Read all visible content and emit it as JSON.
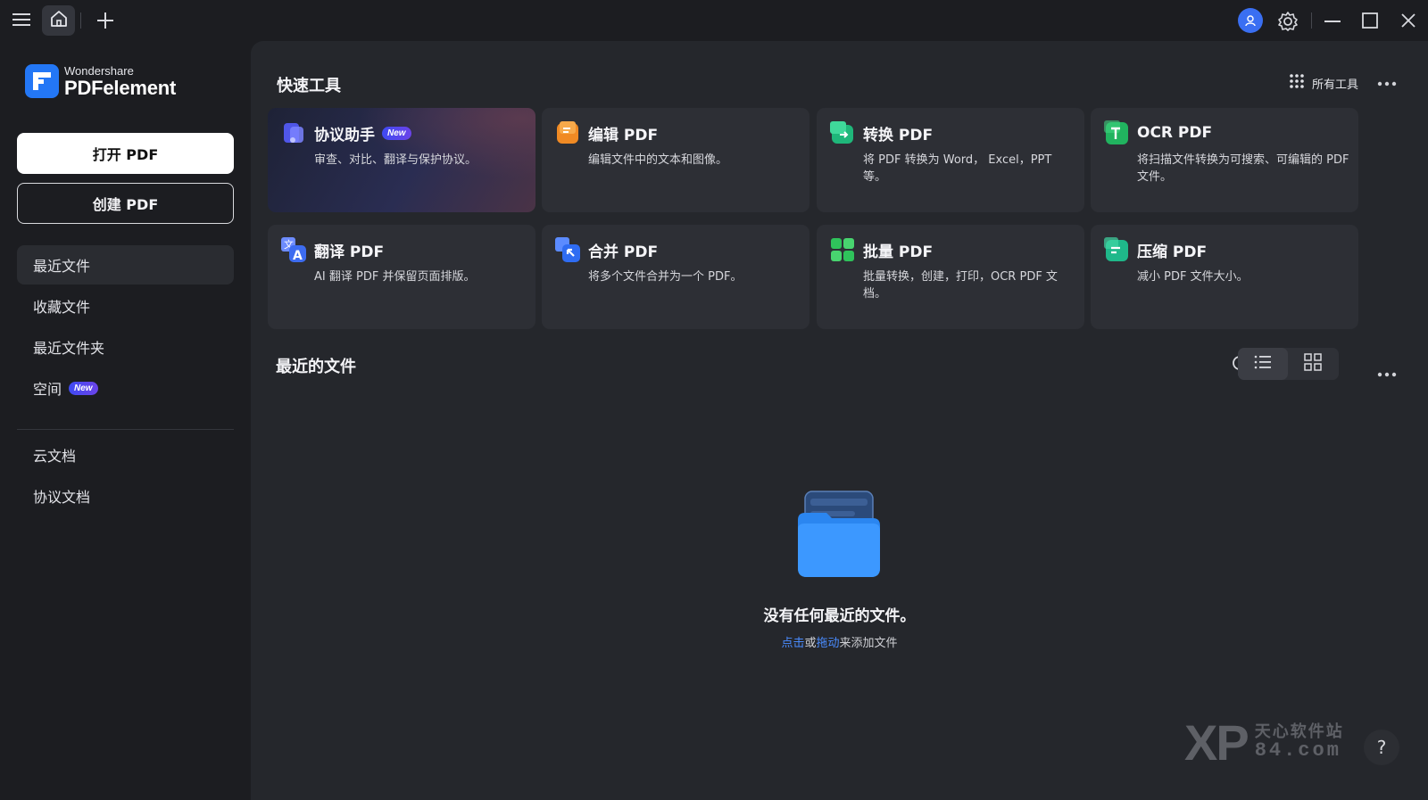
{
  "titlebar": {
    "icons": [
      "menu-icon",
      "home-icon",
      "plus-icon",
      "user-avatar-icon",
      "gear-icon",
      "minimize-icon",
      "maximize-icon",
      "close-icon"
    ]
  },
  "brand": {
    "sub": "Wondershare",
    "main": "PDFelement",
    "color": "#2377f6"
  },
  "sidebar": {
    "open_label": "打开 PDF",
    "create_label": "创建 PDF",
    "items": [
      {
        "label": "最近文件",
        "active": true
      },
      {
        "label": "收藏文件"
      },
      {
        "label": "最近文件夹"
      },
      {
        "label": "空间",
        "badge": "New"
      },
      {
        "label": "云文档"
      },
      {
        "label": "协议文档"
      }
    ]
  },
  "quick_tools": {
    "title": "快速工具",
    "all_tools_label": "所有工具",
    "tools": [
      {
        "name": "协议助手",
        "badge": "New",
        "desc": "审查、对比、翻译与保护协议。",
        "icon": "agreement-assistant-icon",
        "color": "#5a63f0"
      },
      {
        "name": "编辑 PDF",
        "desc": "编辑文件中的文本和图像。",
        "icon": "edit-pdf-icon",
        "color": "#f08a24"
      },
      {
        "name": "转换 PDF",
        "desc": "将 PDF 转换为 Word， Excel，PPT 等。",
        "icon": "convert-pdf-icon",
        "color": "#1fb77a"
      },
      {
        "name": "OCR PDF",
        "desc": "将扫描文件转换为可搜索、可编辑的 PDF 文件。",
        "icon": "ocr-pdf-icon",
        "color": "#21b35f"
      },
      {
        "name": "翻译 PDF",
        "desc": "AI 翻译 PDF 并保留页面排版。",
        "icon": "translate-pdf-icon",
        "color": "#3d6cf0"
      },
      {
        "name": "合并 PDF",
        "desc": "将多个文件合并为一个 PDF。",
        "icon": "merge-pdf-icon",
        "color": "#2f6cf2"
      },
      {
        "name": "批量 PDF",
        "desc": "批量转换，创建，打印，OCR PDF 文档。",
        "icon": "batch-pdf-icon",
        "color": "#2fc25b"
      },
      {
        "name": "压缩 PDF",
        "desc": "减小 PDF 文件大小。",
        "icon": "compress-pdf-icon",
        "color": "#1fb88a"
      }
    ]
  },
  "recent": {
    "title": "最近的文件",
    "empty_title": "没有任何最近的文件。",
    "hint_click": "点击",
    "hint_or": "或",
    "hint_drag": "拖动",
    "hint_rest": "来添加文件"
  },
  "watermark": {
    "xp": "XP",
    "cn": "天心软件站",
    "domain": "84.com"
  },
  "help_label": "?"
}
